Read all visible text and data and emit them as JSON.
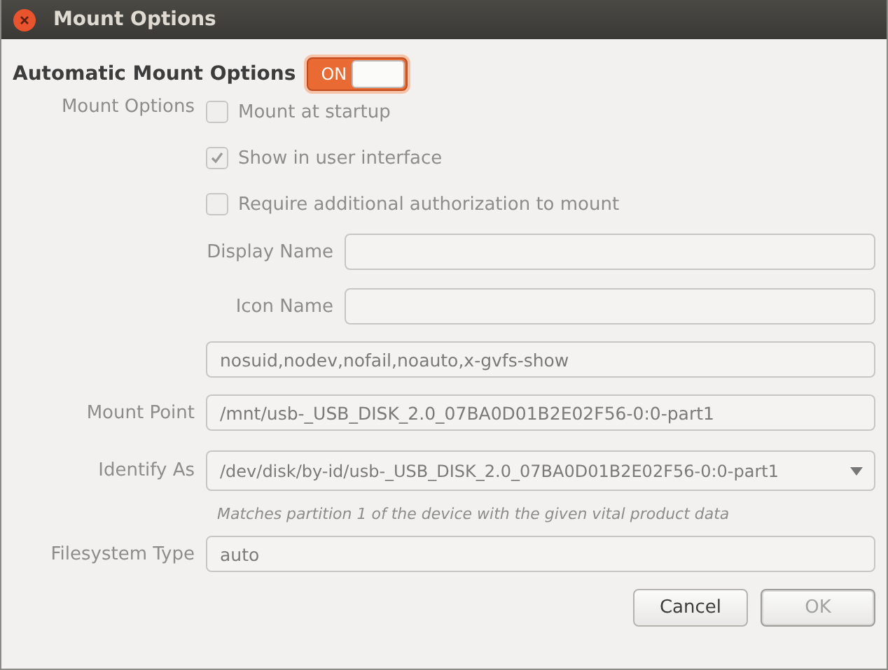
{
  "window": {
    "title": "Mount Options"
  },
  "automatic": {
    "label": "Automatic Mount Options",
    "switch_text": "ON",
    "on": true
  },
  "mount_options": {
    "label": "Mount Options",
    "checkboxes": [
      {
        "label": "Mount at startup",
        "checked": false
      },
      {
        "label": "Show in user interface",
        "checked": true
      },
      {
        "label": "Require additional authorization to mount",
        "checked": false
      }
    ]
  },
  "display_name": {
    "label": "Display Name"
  },
  "icon_name": {
    "label": "Icon Name"
  },
  "options_field": {
    "value": "nosuid,nodev,nofail,noauto,x-gvfs-show"
  },
  "mount_point": {
    "label": "Mount Point",
    "value": "/mnt/usb-_USB_DISK_2.0_07BA0D01B2E02F56-0:0-part1"
  },
  "identify_as": {
    "label": "Identify As",
    "value": "/dev/disk/by-id/usb-_USB_DISK_2.0_07BA0D01B2E02F56-0:0-part1",
    "hint": "Matches partition 1 of the device with the given vital product data"
  },
  "filesystem_type": {
    "label": "Filesystem Type",
    "value": "auto"
  },
  "buttons": [
    {
      "label": "Cancel",
      "disabled": false
    },
    {
      "label": "OK",
      "disabled": true
    }
  ]
}
